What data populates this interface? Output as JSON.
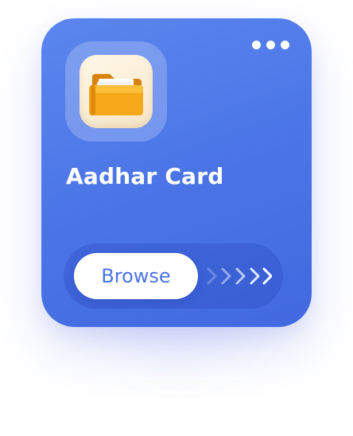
{
  "card": {
    "title": "Aadhar Card",
    "menu_icon": "more-horizontal-icon",
    "folder_icon": "folder-icon",
    "browse_label": "Browse",
    "arrow_icon": "chevrons-right-icon"
  },
  "colors": {
    "card_top": "#5b86ee",
    "card_bottom": "#4269e0",
    "button_bg": "#ffffff",
    "button_text": "#4a74e6",
    "folder": "#f5a623"
  }
}
